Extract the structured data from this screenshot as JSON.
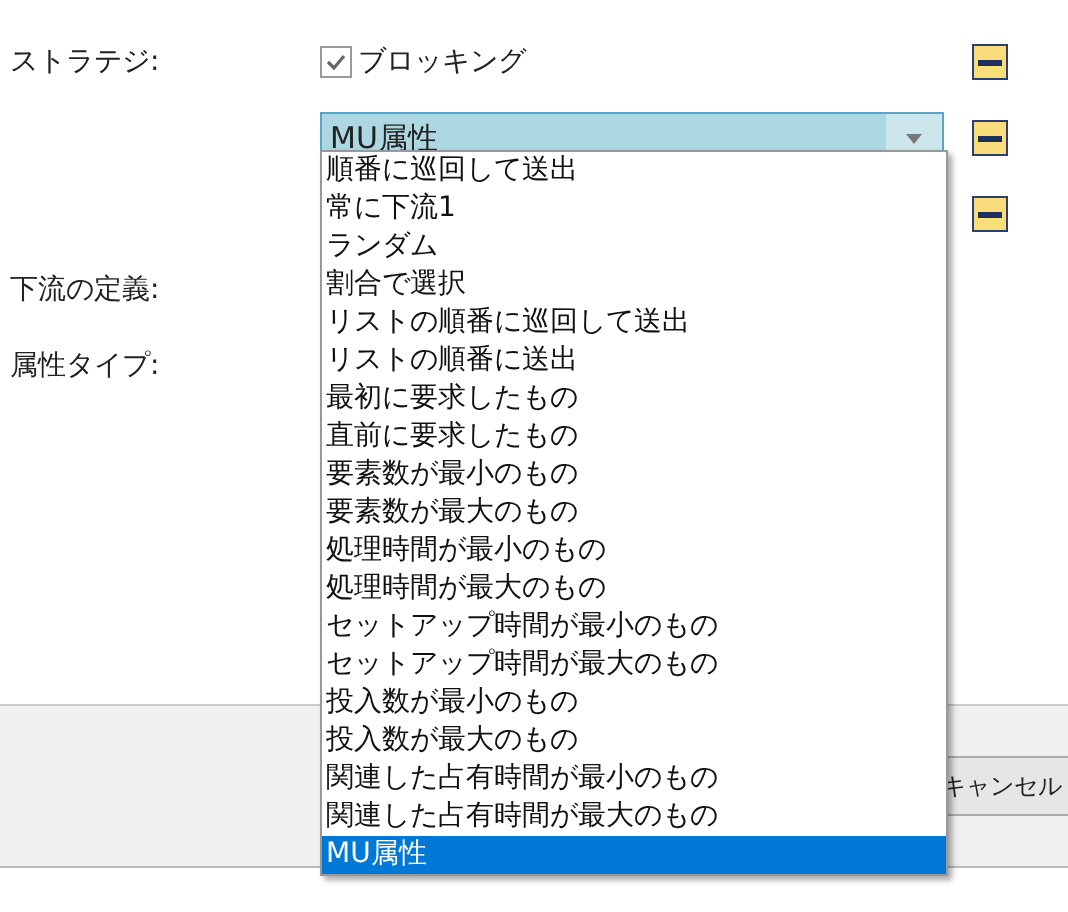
{
  "form": {
    "rows": [
      {
        "kind": "checkbox",
        "label": "ストラテジ:",
        "checkbox": {
          "label": "ブロッキング",
          "checked": true
        },
        "inherit_icon": true
      },
      {
        "kind": "combo",
        "combo": {
          "value": "MU属性",
          "open": true
        },
        "inherit_icon": true
      },
      {
        "kind": "blank",
        "inherit_icon": true
      },
      {
        "kind": "label",
        "label": "下流の定義:"
      },
      {
        "kind": "label",
        "label": "属性タイプ:"
      }
    ]
  },
  "dropdown": {
    "items": [
      {
        "label": "順番に巡回して送出",
        "selected": false
      },
      {
        "label": "常に下流1",
        "selected": false
      },
      {
        "label": "ランダム",
        "selected": false
      },
      {
        "label": "割合で選択",
        "selected": false
      },
      {
        "label": "リストの順番に巡回して送出",
        "selected": false
      },
      {
        "label": "リストの順番に送出",
        "selected": false
      },
      {
        "label": "最初に要求したもの",
        "selected": false
      },
      {
        "label": "直前に要求したもの",
        "selected": false
      },
      {
        "label": "要素数が最小のもの",
        "selected": false
      },
      {
        "label": "要素数が最大のもの",
        "selected": false
      },
      {
        "label": "処理時間が最小のもの",
        "selected": false
      },
      {
        "label": "処理時間が最大のもの",
        "selected": false
      },
      {
        "label": "セットアップ時間が最小のもの",
        "selected": false
      },
      {
        "label": "セットアップ時間が最大のもの",
        "selected": false
      },
      {
        "label": "投入数が最小のもの",
        "selected": false
      },
      {
        "label": "投入数が最大のもの",
        "selected": false
      },
      {
        "label": "関連した占有時間が最小のもの",
        "selected": false
      },
      {
        "label": "関連した占有時間が最大のもの",
        "selected": false
      },
      {
        "label": "MU属性",
        "selected": true
      }
    ]
  },
  "footer": {
    "buttons": [
      "キャンセル"
    ]
  }
}
